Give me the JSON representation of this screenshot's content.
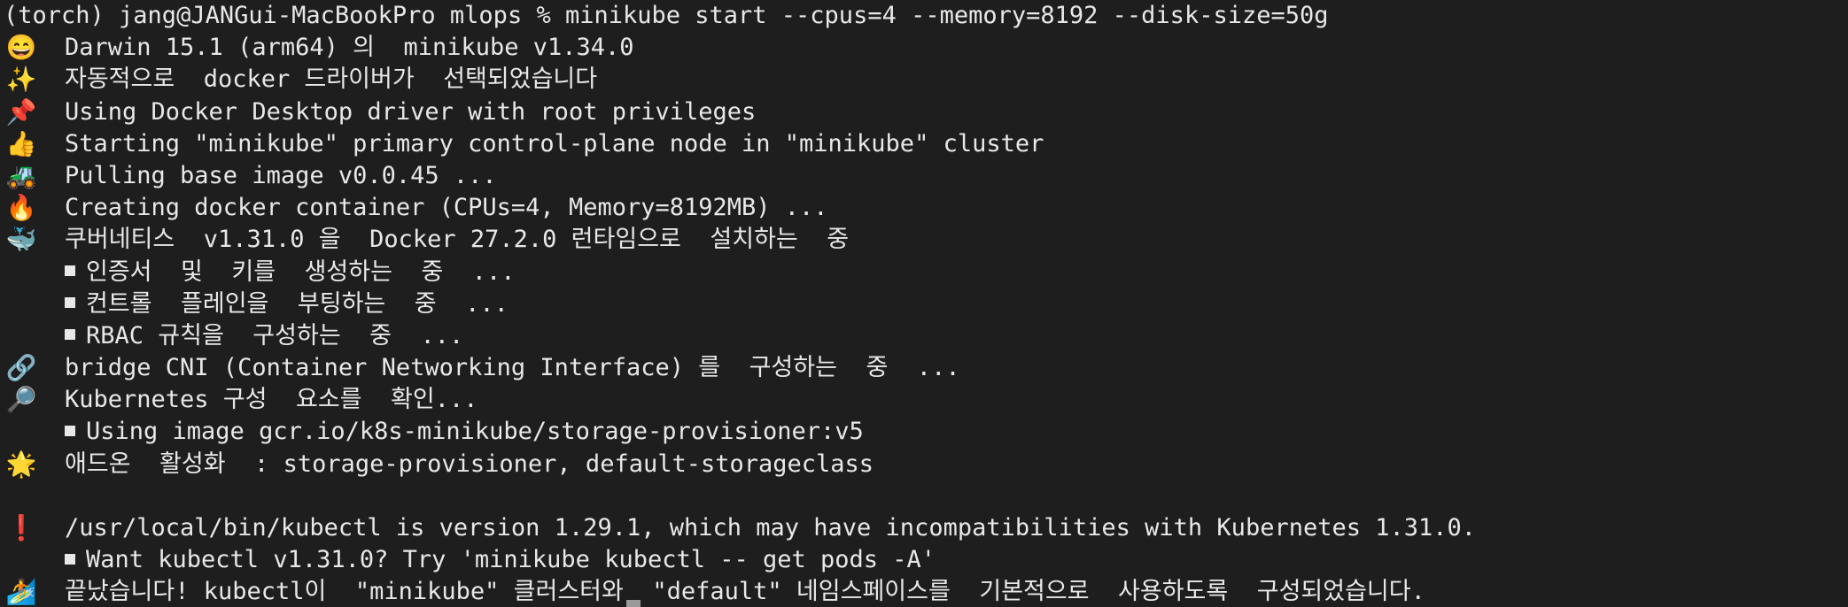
{
  "terminal": {
    "prompt_line": "(torch) jang@JANGui-MacBookPro mlops % minikube start --cpus=4 --memory=8192 --disk-size=50g",
    "lines": [
      {
        "icon": "😄",
        "text": "Darwin 15.1 (arm64) 의  minikube v1.34.0"
      },
      {
        "icon": "✨",
        "text": "자동적으로  docker 드라이버가  선택되었습니다"
      },
      {
        "icon": "📌",
        "text": "Using Docker Desktop driver with root privileges"
      },
      {
        "icon": "👍",
        "text": "Starting \"minikube\" primary control-plane node in \"minikube\" cluster"
      },
      {
        "icon": "🚜",
        "text": "Pulling base image v0.0.45 ..."
      },
      {
        "icon": "🔥",
        "text": "Creating docker container (CPUs=4, Memory=8192MB) ..."
      },
      {
        "icon": "🐳",
        "text": "쿠버네티스  v1.31.0 을  Docker 27.2.0 런타임으로  설치하는  중"
      },
      {
        "icon": "",
        "text": "인증서  및  키를  생성하는  중  ..."
      },
      {
        "icon": "",
        "text": "컨트롤  플레인을  부팅하는  중  ..."
      },
      {
        "icon": "",
        "text": "RBAC 규칙을  구성하는  중  ..."
      },
      {
        "icon": "🔗",
        "text": "bridge CNI (Container Networking Interface) 를  구성하는  중  ..."
      },
      {
        "icon": "🔎",
        "text": "Kubernetes 구성  요소를  확인..."
      },
      {
        "icon": "",
        "text": "Using image gcr.io/k8s-minikube/storage-provisioner:v5"
      },
      {
        "icon": "🌟",
        "text": "애드온  활성화  : storage-provisioner, default-storageclass"
      },
      {
        "icon": "",
        "text": ""
      },
      {
        "icon": "❗",
        "text": "/usr/local/bin/kubectl is version 1.29.1, which may have incompatibilities with Kubernetes 1.31.0."
      },
      {
        "icon": "",
        "text": "Want kubectl v1.31.0? Try 'minikube kubectl -- get pods -A'"
      },
      {
        "icon": "🏄",
        "text": "끝났습니다! kubectl이  \"minikube\" 클러스터와  \"default\" 네임스페이스를  기본적으로  사용하도록  구성되었습니다."
      }
    ]
  }
}
